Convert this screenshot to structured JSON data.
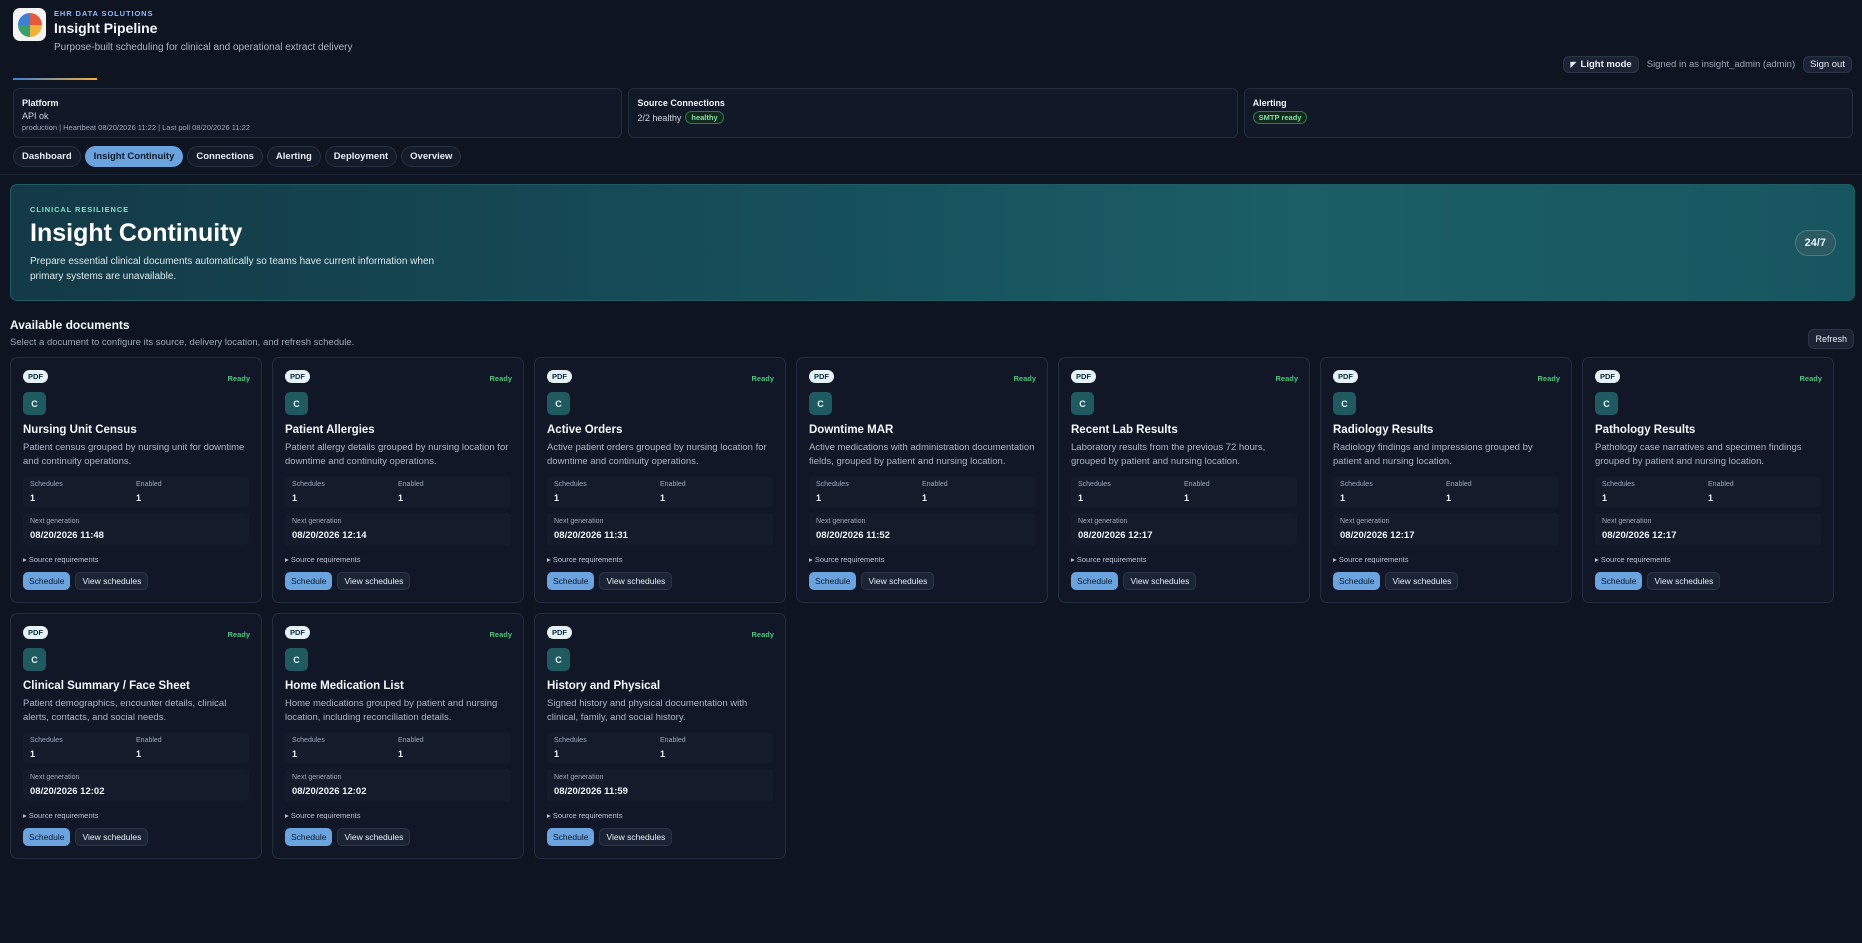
{
  "brand": {
    "kicker": "EHR DATA SOLUTIONS",
    "title": "Insight Pipeline",
    "subtitle": "Purpose-built scheduling for clinical and operational extract delivery"
  },
  "user": {
    "mode_label": "Light mode",
    "signed_in": "Signed in as insight_admin (admin)",
    "sign_out": "Sign out"
  },
  "status": {
    "platform": {
      "title": "Platform",
      "line": "API ok",
      "meta": "production | Heartbeat 08/20/2026 11:22 | Last poll 08/20/2026 11:22"
    },
    "sources": {
      "title": "Source Connections",
      "line": "2/2 healthy",
      "badge": "healthy"
    },
    "alerting": {
      "title": "Alerting",
      "badge": "SMTP ready"
    }
  },
  "tabs": [
    "Dashboard",
    "Insight Continuity",
    "Connections",
    "Alerting",
    "Deployment",
    "Overview"
  ],
  "hero": {
    "kicker": "CLINICAL RESILIENCE",
    "title": "Insight Continuity",
    "description": "Prepare essential clinical documents automatically so teams have current information when primary systems are unavailable.",
    "badge": "24/7"
  },
  "section": {
    "title": "Available documents",
    "subtitle": "Select a document to configure its source, delivery location, and refresh schedule.",
    "refresh": "Refresh"
  },
  "labels": {
    "pdf": "PDF",
    "ready": "Ready",
    "icon_letter": "C",
    "schedules": "Schedules",
    "enabled": "Enabled",
    "next_generation": "Next generation",
    "source_requirements": "▸ Source requirements",
    "schedule": "Schedule",
    "view_schedules": "View schedules"
  },
  "documents": [
    {
      "title": "Nursing Unit Census",
      "description": "Patient census grouped by nursing unit for downtime and continuity operations.",
      "schedules": "1",
      "enabled": "1",
      "next": "08/20/2026 11:48"
    },
    {
      "title": "Patient Allergies",
      "description": "Patient allergy details grouped by nursing location for downtime and continuity operations.",
      "schedules": "1",
      "enabled": "1",
      "next": "08/20/2026 12:14"
    },
    {
      "title": "Active Orders",
      "description": "Active patient orders grouped by nursing location for downtime and continuity operations.",
      "schedules": "1",
      "enabled": "1",
      "next": "08/20/2026 11:31"
    },
    {
      "title": "Downtime MAR",
      "description": "Active medications with administration documentation fields, grouped by patient and nursing location.",
      "schedules": "1",
      "enabled": "1",
      "next": "08/20/2026 11:52"
    },
    {
      "title": "Recent Lab Results",
      "description": "Laboratory results from the previous 72 hours, grouped by patient and nursing location.",
      "schedules": "1",
      "enabled": "1",
      "next": "08/20/2026 12:17"
    },
    {
      "title": "Radiology Results",
      "description": "Radiology findings and impressions grouped by patient and nursing location.",
      "schedules": "1",
      "enabled": "1",
      "next": "08/20/2026 12:17"
    },
    {
      "title": "Pathology Results",
      "description": "Pathology case narratives and specimen findings grouped by patient and nursing location.",
      "schedules": "1",
      "enabled": "1",
      "next": "08/20/2026 12:17"
    },
    {
      "title": "Clinical Summary / Face Sheet",
      "description": "Patient demographics, encounter details, clinical alerts, contacts, and social needs.",
      "schedules": "1",
      "enabled": "1",
      "next": "08/20/2026 12:02"
    },
    {
      "title": "Home Medication List",
      "description": "Home medications grouped by patient and nursing location, including reconciliation details.",
      "schedules": "1",
      "enabled": "1",
      "next": "08/20/2026 12:02"
    },
    {
      "title": "History and Physical",
      "description": "Signed history and physical documentation with clinical, family, and social history.",
      "schedules": "1",
      "enabled": "1",
      "next": "08/20/2026 11:59"
    }
  ],
  "colors": {
    "accent": "#6aa3de",
    "ready": "#4fc27e",
    "background": "#0e1420"
  }
}
